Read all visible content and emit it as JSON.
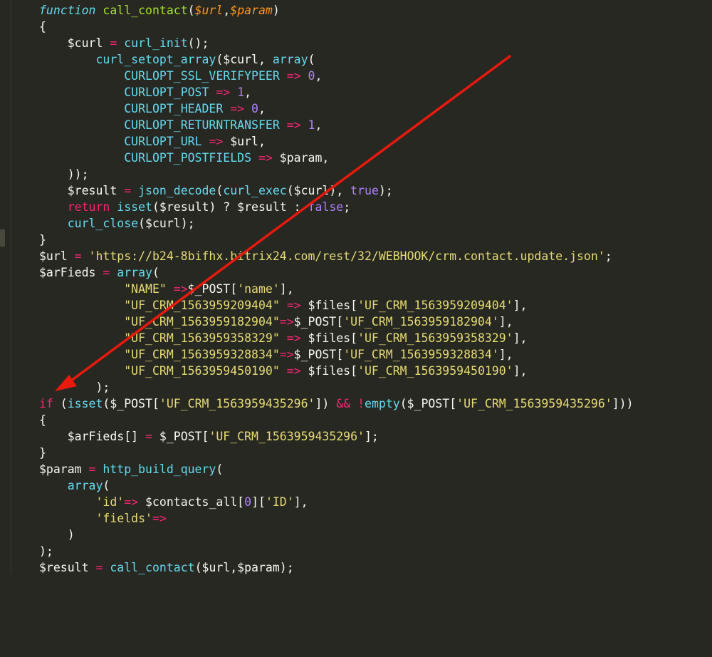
{
  "editor": {
    "lines": [
      [
        {
          "t": "function",
          "c": "kwi"
        },
        {
          "t": " "
        },
        {
          "t": "call_contact",
          "c": "fn"
        },
        {
          "t": "("
        },
        {
          "t": "$url",
          "c": "param"
        },
        {
          "t": ","
        },
        {
          "t": "$param",
          "c": "param"
        },
        {
          "t": ")"
        }
      ],
      [
        {
          "t": "{"
        }
      ],
      [
        {
          "t": "    $curl "
        },
        {
          "t": "=",
          "c": "op"
        },
        {
          "t": " "
        },
        {
          "t": "curl_init",
          "c": "const"
        },
        {
          "t": "();"
        }
      ],
      [
        {
          "t": "        "
        },
        {
          "t": "curl_setopt_array",
          "c": "const"
        },
        {
          "t": "($curl, "
        },
        {
          "t": "array",
          "c": "const"
        },
        {
          "t": "("
        }
      ],
      [
        {
          "t": "            "
        },
        {
          "t": "CURLOPT_SSL_VERIFYPEER",
          "c": "const"
        },
        {
          "t": " "
        },
        {
          "t": "=>",
          "c": "op"
        },
        {
          "t": " "
        },
        {
          "t": "0",
          "c": "num"
        },
        {
          "t": ","
        }
      ],
      [
        {
          "t": "            "
        },
        {
          "t": "CURLOPT_POST",
          "c": "const"
        },
        {
          "t": " "
        },
        {
          "t": "=>",
          "c": "op"
        },
        {
          "t": " "
        },
        {
          "t": "1",
          "c": "num"
        },
        {
          "t": ","
        }
      ],
      [
        {
          "t": "            "
        },
        {
          "t": "CURLOPT_HEADER",
          "c": "const"
        },
        {
          "t": " "
        },
        {
          "t": "=>",
          "c": "op"
        },
        {
          "t": " "
        },
        {
          "t": "0",
          "c": "num"
        },
        {
          "t": ","
        }
      ],
      [
        {
          "t": "            "
        },
        {
          "t": "CURLOPT_RETURNTRANSFER",
          "c": "const"
        },
        {
          "t": " "
        },
        {
          "t": "=>",
          "c": "op"
        },
        {
          "t": " "
        },
        {
          "t": "1",
          "c": "num"
        },
        {
          "t": ","
        }
      ],
      [
        {
          "t": "            "
        },
        {
          "t": "CURLOPT_URL",
          "c": "const"
        },
        {
          "t": " "
        },
        {
          "t": "=>",
          "c": "op"
        },
        {
          "t": " $url,"
        }
      ],
      [
        {
          "t": "            "
        },
        {
          "t": "CURLOPT_POSTFIELDS",
          "c": "const"
        },
        {
          "t": " "
        },
        {
          "t": "=>",
          "c": "op"
        },
        {
          "t": " $param,"
        }
      ],
      [
        {
          "t": "    ));"
        }
      ],
      [
        {
          "t": "    $result "
        },
        {
          "t": "=",
          "c": "op"
        },
        {
          "t": " "
        },
        {
          "t": "json_decode",
          "c": "const"
        },
        {
          "t": "("
        },
        {
          "t": "curl_exec",
          "c": "const"
        },
        {
          "t": "($curl), "
        },
        {
          "t": "true",
          "c": "bool"
        },
        {
          "t": ");"
        }
      ],
      [
        {
          "t": "    "
        },
        {
          "t": "return",
          "c": "kw"
        },
        {
          "t": " "
        },
        {
          "t": "isset",
          "c": "const"
        },
        {
          "t": "($result) ? $result : "
        },
        {
          "t": "false",
          "c": "bool"
        },
        {
          "t": ";"
        }
      ],
      [
        {
          "t": "    "
        },
        {
          "t": "curl_close",
          "c": "const"
        },
        {
          "t": "($curl);"
        }
      ],
      [
        {
          "t": "}"
        }
      ],
      [
        {
          "t": "$url "
        },
        {
          "t": "=",
          "c": "op"
        },
        {
          "t": " "
        },
        {
          "t": "'https://b24-8bifhx.bitrix24.com/rest/32/WEBHOOK/crm.contact.update.json'",
          "c": "str"
        },
        {
          "t": ";"
        }
      ],
      [
        {
          "t": "$arFieds "
        },
        {
          "t": "=",
          "c": "op"
        },
        {
          "t": " "
        },
        {
          "t": "array",
          "c": "const"
        },
        {
          "t": "("
        }
      ],
      [
        {
          "t": "            "
        },
        {
          "t": "\"NAME\"",
          "c": "str"
        },
        {
          "t": " "
        },
        {
          "t": "=>",
          "c": "op"
        },
        {
          "t": "$_POST["
        },
        {
          "t": "'name'",
          "c": "str"
        },
        {
          "t": "],"
        }
      ],
      [
        {
          "t": "            "
        },
        {
          "t": "\"UF_CRM_1563959209404\"",
          "c": "str"
        },
        {
          "t": " "
        },
        {
          "t": "=>",
          "c": "op"
        },
        {
          "t": " $files["
        },
        {
          "t": "'UF_CRM_1563959209404'",
          "c": "str"
        },
        {
          "t": "],"
        }
      ],
      [
        {
          "t": "            "
        },
        {
          "t": "\"UF_CRM_1563959182904\"",
          "c": "str"
        },
        {
          "t": "=>",
          "c": "op"
        },
        {
          "t": "$_POST["
        },
        {
          "t": "'UF_CRM_1563959182904'",
          "c": "str"
        },
        {
          "t": "],"
        }
      ],
      [
        {
          "t": "            "
        },
        {
          "t": "\"UF_CRM_1563959358329\"",
          "c": "str"
        },
        {
          "t": " "
        },
        {
          "t": "=>",
          "c": "op"
        },
        {
          "t": " $files["
        },
        {
          "t": "'UF_CRM_1563959358329'",
          "c": "str"
        },
        {
          "t": "],"
        }
      ],
      [
        {
          "t": "            "
        },
        {
          "t": "\"UF_CRM_1563959328834\"",
          "c": "str"
        },
        {
          "t": "=>",
          "c": "op"
        },
        {
          "t": "$_POST["
        },
        {
          "t": "'UF_CRM_1563959328834'",
          "c": "str"
        },
        {
          "t": "],"
        }
      ],
      [
        {
          "t": "            "
        },
        {
          "t": "\"UF_CRM_1563959450190\"",
          "c": "str"
        },
        {
          "t": " "
        },
        {
          "t": "=>",
          "c": "op"
        },
        {
          "t": " $files["
        },
        {
          "t": "'UF_CRM_1563959450190'",
          "c": "str"
        },
        {
          "t": "],"
        }
      ],
      [
        {
          "t": "        );"
        }
      ],
      [
        {
          "t": "if",
          "c": "kw"
        },
        {
          "t": " ("
        },
        {
          "t": "isset",
          "c": "const"
        },
        {
          "t": "($_POST["
        },
        {
          "t": "'UF_CRM_1563959435296'",
          "c": "str"
        },
        {
          "t": "]) "
        },
        {
          "t": "&&",
          "c": "op"
        },
        {
          "t": " "
        },
        {
          "t": "!",
          "c": "op"
        },
        {
          "t": "empty",
          "c": "const"
        },
        {
          "t": "($_POST["
        },
        {
          "t": "'UF_CRM_1563959435296'",
          "c": "str"
        },
        {
          "t": "]))"
        }
      ],
      [
        {
          "t": "{"
        }
      ],
      [
        {
          "t": "    $arFieds[] "
        },
        {
          "t": "=",
          "c": "op"
        },
        {
          "t": " $_POST["
        },
        {
          "t": "'UF_CRM_1563959435296'",
          "c": "str"
        },
        {
          "t": "];"
        }
      ],
      [
        {
          "t": "}"
        }
      ],
      [
        {
          "t": "$param "
        },
        {
          "t": "=",
          "c": "op"
        },
        {
          "t": " "
        },
        {
          "t": "http_build_query",
          "c": "const"
        },
        {
          "t": "("
        }
      ],
      [
        {
          "t": "    "
        },
        {
          "t": "array",
          "c": "const"
        },
        {
          "t": "("
        }
      ],
      [
        {
          "t": "        "
        },
        {
          "t": "'id'",
          "c": "str"
        },
        {
          "t": "=>",
          "c": "op"
        },
        {
          "t": " $contacts_all["
        },
        {
          "t": "0",
          "c": "num"
        },
        {
          "t": "]["
        },
        {
          "t": "'ID'",
          "c": "str"
        },
        {
          "t": "],"
        }
      ],
      [
        {
          "t": "        "
        },
        {
          "t": "'fields'",
          "c": "str"
        },
        {
          "t": "=>",
          "c": "op"
        }
      ],
      [
        {
          "t": "    )"
        }
      ],
      [
        {
          "t": ");"
        }
      ],
      [
        {
          "t": "$result "
        },
        {
          "t": "=",
          "c": "op"
        },
        {
          "t": " "
        },
        {
          "t": "call_contact",
          "c": "const"
        },
        {
          "t": "($url,$param);"
        }
      ]
    ]
  },
  "annotation": {
    "color": "#e8190d"
  },
  "colors": {
    "background": "#272822",
    "foreground": "#f8f8f2"
  }
}
